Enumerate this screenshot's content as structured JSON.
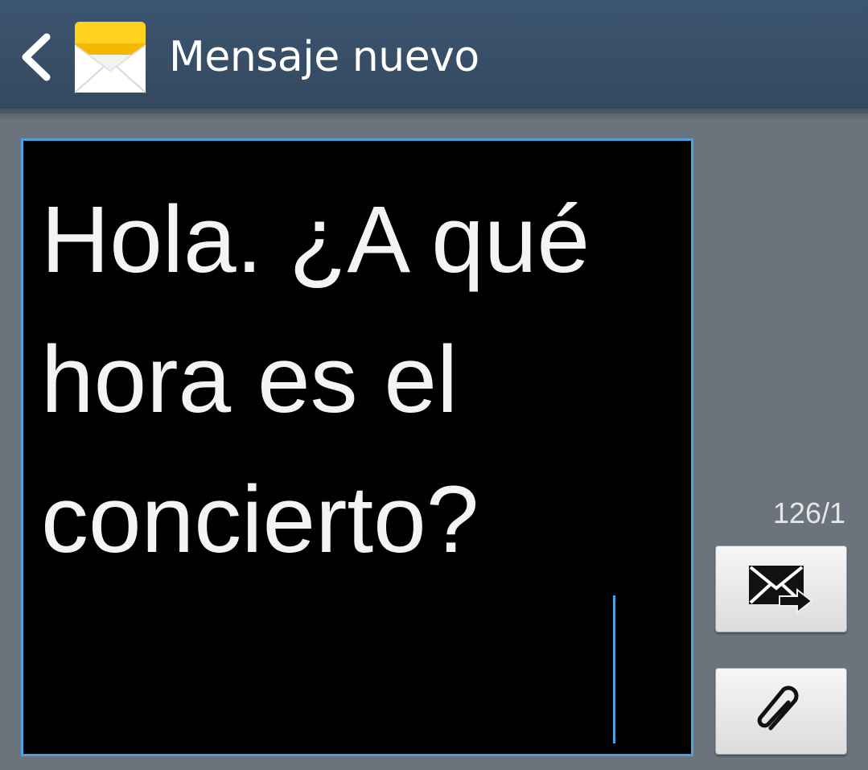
{
  "header": {
    "title": "Mensaje nuevo"
  },
  "composer": {
    "message_text": "Hola. ¿A qué hora es el concierto?",
    "char_counter": "126/1"
  },
  "icons": {
    "back": "chevron-left-icon",
    "app": "envelope-app-icon",
    "send": "send-message-icon",
    "attach": "paperclip-icon"
  },
  "colors": {
    "header_bg": "#3c5570",
    "body_bg": "#6b737d",
    "message_bg": "#000000",
    "accent": "#4aa3df",
    "text": "#ffffff"
  }
}
